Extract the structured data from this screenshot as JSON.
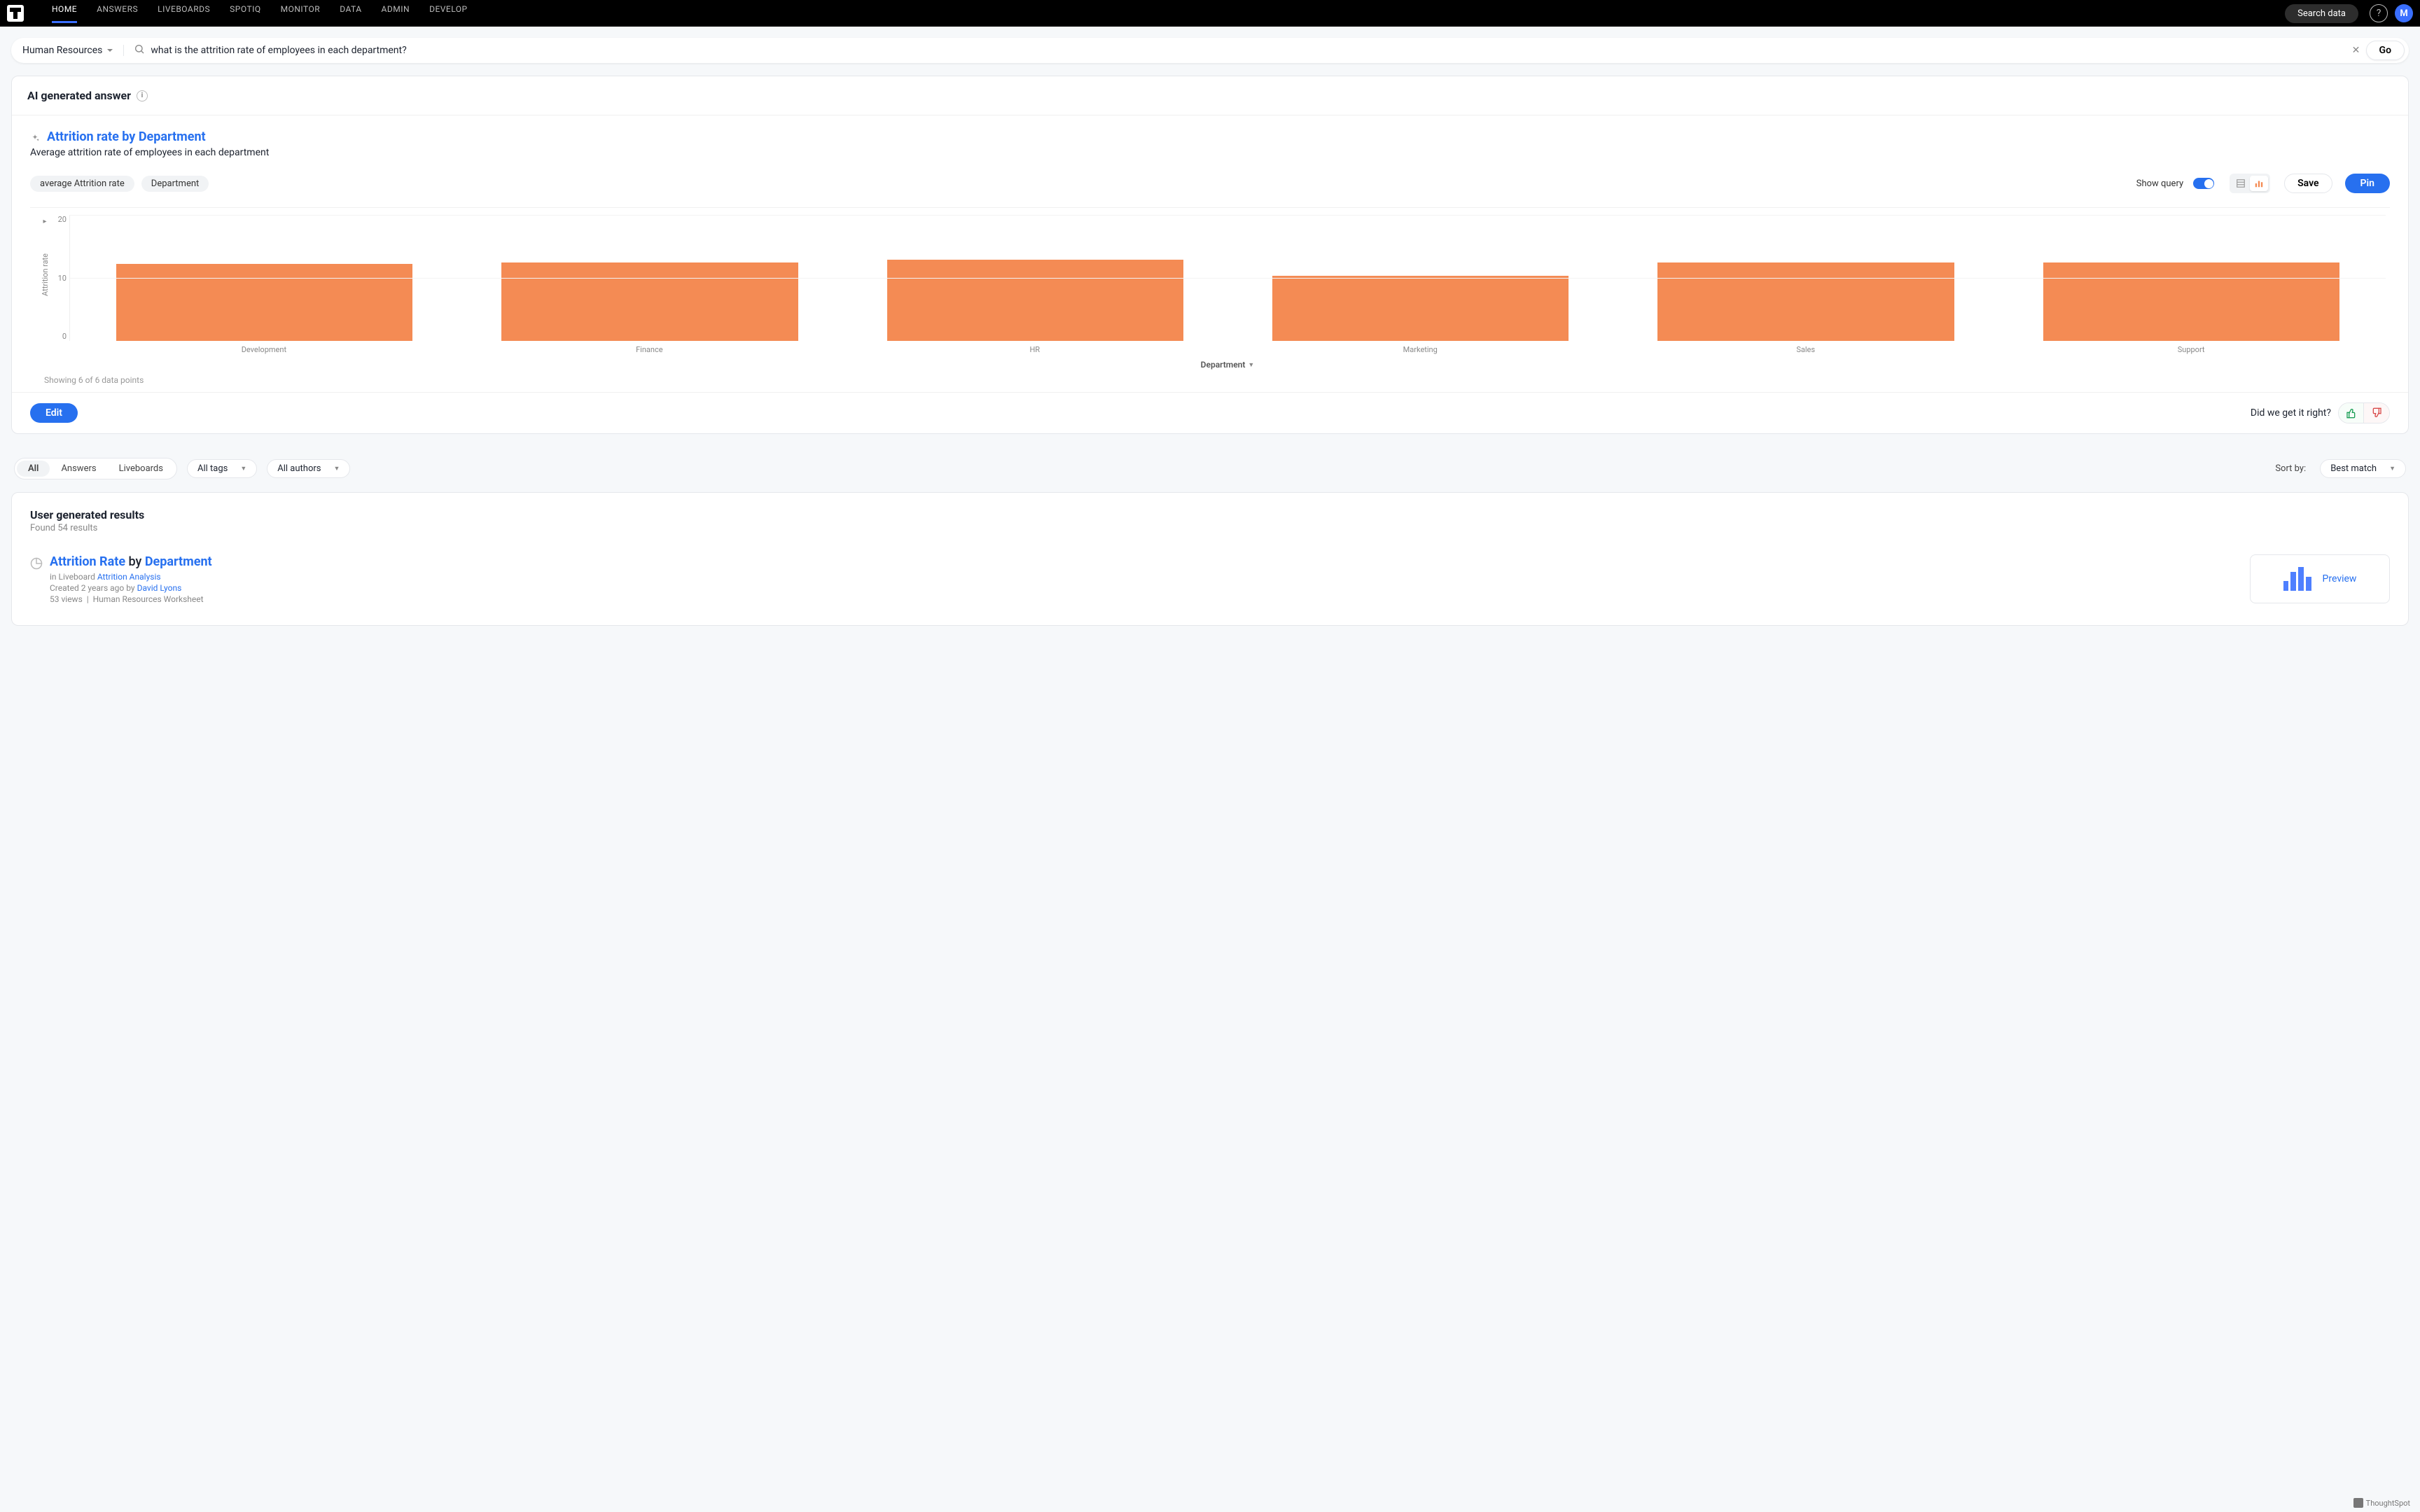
{
  "nav": {
    "links": [
      "HOME",
      "ANSWERS",
      "LIVEBOARDS",
      "SPOTIQ",
      "MONITOR",
      "DATA",
      "ADMIN",
      "DEVELOP"
    ],
    "active_index": 0,
    "search_data_btn": "Search data",
    "help_glyph": "?",
    "avatar_initial": "M"
  },
  "search": {
    "datasource": "Human Resources",
    "query": "what is the attrition rate of employees in each department?",
    "go_label": "Go"
  },
  "ai": {
    "header": "AI generated answer",
    "title": "Attrition rate by Department",
    "subtitle": "Average attrition rate of employees in each department",
    "chips": [
      "average Attrition rate",
      "Department"
    ],
    "show_query_label": "Show query",
    "save_label": "Save",
    "pin_label": "Pin",
    "x_axis_label": "Department",
    "y_axis_label": "Attrition rate",
    "data_points_text": "Showing 6 of 6 data points",
    "y_ticks": [
      "20",
      "10",
      "0"
    ],
    "edit_label": "Edit",
    "feedback_prompt": "Did we get it right?"
  },
  "chart_data": {
    "type": "bar",
    "categories": [
      "Development",
      "Finance",
      "HR",
      "Marketing",
      "Sales",
      "Support"
    ],
    "values": [
      12.2,
      12.4,
      12.9,
      10.3,
      12.5,
      12.4
    ],
    "title": "Attrition rate by Department",
    "xlabel": "Department",
    "ylabel": "Attrition rate",
    "ylim": [
      0,
      20
    ]
  },
  "filters": {
    "segments": [
      "All",
      "Answers",
      "Liveboards"
    ],
    "active_segment": 0,
    "tags_label": "All tags",
    "authors_label": "All authors",
    "sort_by_label": "Sort by:",
    "sort_value": "Best match"
  },
  "results": {
    "header": "User generated results",
    "count_text": "Found 54 results",
    "items": [
      {
        "title_prefix": "Attrition Rate",
        "title_mid": " by ",
        "title_suffix": "Department",
        "liveboard_label": "in Liveboard ",
        "liveboard_name": "Attrition Analysis",
        "created_prefix": "Created 2 years ago by ",
        "author": "David Lyons",
        "views": "53 views",
        "worksheet": "Human Resources Worksheet",
        "preview_label": "Preview"
      }
    ]
  },
  "footer": {
    "brand": "ThoughtSpot"
  },
  "colors": {
    "accent": "#2770ef",
    "bar": "#f48b54"
  }
}
